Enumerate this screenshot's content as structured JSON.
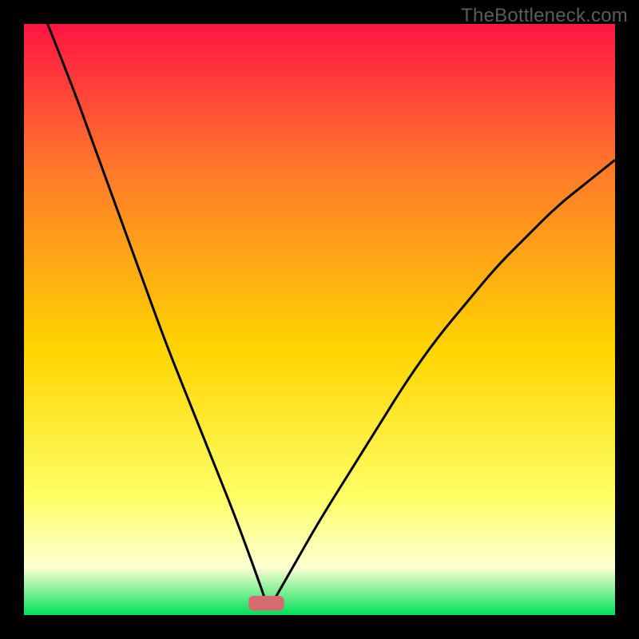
{
  "watermark": "TheBottleneck.com",
  "colors": {
    "frame": "#000000",
    "gradient_top": "#ff1544",
    "gradient_mid_upper": "#ff7a2a",
    "gradient_mid": "#ffd400",
    "gradient_lower": "#ffff66",
    "gradient_pale": "#fdffd2",
    "gradient_bottom": "#00e059",
    "curve_stroke": "#000000",
    "marker_fill": "#d76a6f"
  },
  "chart_data": {
    "type": "line",
    "title": "",
    "xlabel": "",
    "ylabel": "",
    "xlim": [
      0,
      100
    ],
    "ylim": [
      0,
      100
    ],
    "note": "Approximate V-shaped bottleneck curve. Left branch from top-left falling to minimum; right branch rising from minimum toward upper-right. Values estimated from pixels.",
    "minimum_x": 41,
    "minimum_y": 2,
    "series": [
      {
        "name": "left_branch",
        "x": [
          4,
          8,
          12,
          16,
          20,
          24,
          28,
          32,
          36,
          40,
          41
        ],
        "y": [
          100,
          90,
          79,
          68,
          57,
          46,
          36,
          26,
          16,
          5,
          2
        ]
      },
      {
        "name": "right_branch",
        "x": [
          42,
          46,
          50,
          55,
          60,
          65,
          70,
          75,
          80,
          85,
          90,
          95,
          100
        ],
        "y": [
          2,
          9,
          16,
          24,
          32,
          40,
          47,
          53,
          59,
          64,
          69,
          73,
          77
        ]
      }
    ],
    "marker": {
      "shape": "rounded-rect",
      "x_center": 41,
      "y_center": 2,
      "width": 6,
      "height": 2.5
    },
    "background_gradient_stops_pct_from_top": [
      {
        "pct": 0,
        "color": "#ff1544"
      },
      {
        "pct": 25,
        "color": "#ff7a2a"
      },
      {
        "pct": 55,
        "color": "#ffd400"
      },
      {
        "pct": 80,
        "color": "#ffff66"
      },
      {
        "pct": 92,
        "color": "#fdffd2"
      },
      {
        "pct": 100,
        "color": "#00e059"
      }
    ]
  }
}
